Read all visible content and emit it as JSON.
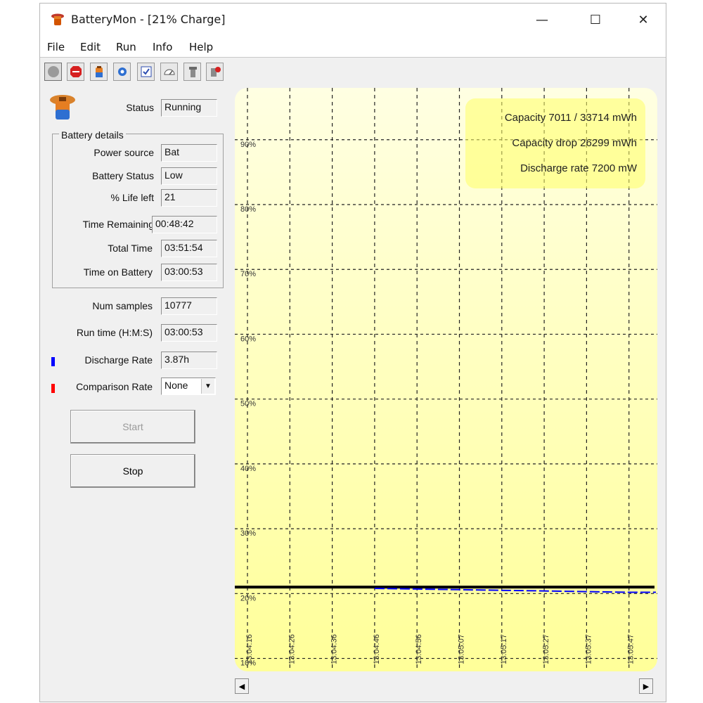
{
  "window": {
    "title": "BatteryMon - [21% Charge]",
    "minimize_glyph": "—",
    "maximize_glyph": "☐",
    "close_glyph": "✕"
  },
  "menu": [
    "File",
    "Edit",
    "Run",
    "Info",
    "Help"
  ],
  "toolbar": {
    "icons": [
      "record-icon",
      "stop-icon",
      "battery-icon",
      "settings-icon",
      "checklist-icon",
      "gauge-icon",
      "tool-icon",
      "info-icon"
    ]
  },
  "status": {
    "label": "Status",
    "value": "Running"
  },
  "battery_details": {
    "title": "Battery details",
    "fields": [
      {
        "label": "Power source",
        "value": "Bat"
      },
      {
        "label": "Battery Status",
        "value": "Low"
      },
      {
        "label": "% Life left",
        "value": "21"
      },
      {
        "label": "Time Remaining",
        "value": "00:48:42"
      },
      {
        "label": "Total Time",
        "value": "03:51:54"
      },
      {
        "label": "Time on Battery",
        "value": "03:00:53"
      }
    ]
  },
  "num_samples": {
    "label": "Num samples",
    "value": "10777"
  },
  "run_time": {
    "label": "Run time (H:M:S)",
    "value": "03:00:53"
  },
  "discharge_rate": {
    "label": "Discharge Rate",
    "value": "3.87h",
    "color": "#0000ff"
  },
  "comparison_rate": {
    "label": "Comparison Rate",
    "value": "None",
    "color": "#ff0000"
  },
  "buttons": {
    "start": "Start",
    "stop": "Stop"
  },
  "scroll": {
    "left": "◀",
    "right": "▶"
  },
  "chart_data": {
    "type": "line",
    "y_ticks": [
      "90%",
      "80%",
      "70%",
      "60%",
      "50%",
      "40%",
      "30%",
      "20%",
      "10%"
    ],
    "x_ticks": [
      "13:04:16",
      "13:04:26",
      "13:04:36",
      "13:04:46",
      "13:04:56",
      "13:05:07",
      "13:05:17",
      "13:05:27",
      "13:05:37",
      "13:05:47"
    ],
    "ylim": [
      8,
      98
    ],
    "series": [
      {
        "color": "#000000",
        "values": [
          21,
          21,
          21,
          21,
          21,
          21,
          21,
          21,
          21,
          21
        ]
      },
      {
        "color": "#0000ff",
        "values": [
          null,
          null,
          null,
          20.8,
          20.7,
          20.6,
          20.5,
          20.4,
          20.3,
          20.2
        ]
      }
    ],
    "info": [
      "Capacity 7011 / 33714 mWh",
      "Capacity drop 26299 mWh",
      "Discharge rate 7200 mW"
    ],
    "background": "#ffff99",
    "grid": true
  }
}
